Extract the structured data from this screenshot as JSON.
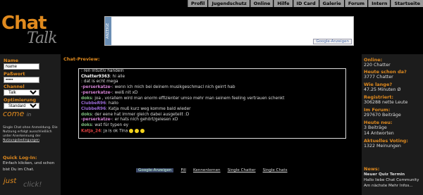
{
  "topnav": [
    "Profil",
    "Jugendschutz",
    "Online",
    "Hilfe",
    "ID Card",
    "Galerie",
    "Forum",
    "Intern",
    "Startseite"
  ],
  "logo": {
    "chat": "Chat",
    "talk": "Talk"
  },
  "ad": {
    "label": "ANZEIGE",
    "google": "Google-Anzeigen"
  },
  "login": {
    "name_label": "Name",
    "name_value": "Name",
    "password_label": "Paßwort",
    "password_value": "•••••",
    "channel_label": "Channel",
    "channel_value": "Talk",
    "opt_label": "Optimierung",
    "opt_value": "Standard",
    "come": "come",
    "come_small": "in",
    "note_text": "Single Chat ohne Anmeldung. Die Nutzung erfolgt ausschließlich unter Anerkennung der",
    "note_link": "Nutzungsbedingungen",
    "quick_title": "Quick Log-In:",
    "quick_text": "Einfach klicken, und schon bist Du im Chat.",
    "just": "just",
    "click": "click!"
  },
  "main": {
    "title": "Chat-Preview:",
    "lines": [
      {
        "name": "",
        "text": ": ren Intuitiv handeln",
        "color": "#dddddd"
      },
      {
        "name": "Chatter9363",
        "text": ": hi alle",
        "color": "#ffffff"
      },
      {
        "name": "",
        "text": ": dat is echt mega",
        "color": "#dddddd"
      },
      {
        "name": "-perserkatze-",
        "text": ": wenn ich mich bei deinem musikgeschmacl nich geirrt hab",
        "color": "#d080d0"
      },
      {
        "name": "-perserkatze-",
        "text": ": weiß nit xD",
        "color": "#d080d0"
      },
      {
        "name": "doks",
        "text": ": joa , vorallem wird man enorm effizienter umso mehr man seinem feeling vertrauen schenkt",
        "color": "#7fbf7f"
      },
      {
        "name": "ClubbeR96",
        "text": ": hallo",
        "color": "#9b6bd6"
      },
      {
        "name": "ClubbeR96",
        "text": ": Katja muß kurz weg komme bald wieder",
        "color": "#9b6bd6"
      },
      {
        "name": "doks",
        "text": ": der eene hat immer gleich dabei ausgeteilt :D",
        "color": "#7fbf7f"
      },
      {
        "name": "-perserkatze-",
        "text": ": er hats nich gehört/gelesen xD",
        "color": "#d080d0"
      },
      {
        "name": "doks",
        "text": ": wat für typen ey",
        "color": "#7fbf7f"
      },
      {
        "name": "Katja_24",
        "text": ": ja is ok Tina",
        "color": "#e04040"
      }
    ],
    "footer_links": [
      "Google-Anzeigen",
      "Fill",
      "Kennenlernen",
      "Single Chatter",
      "Single Chats"
    ],
    "colors": {
      "accent": "#e08a1e",
      "panel": "#1c1c1c"
    }
  },
  "stats": [
    {
      "title": "Online:",
      "value": "220 Chatter"
    },
    {
      "title": "Heute schon da?",
      "value": "3777 Chatter"
    },
    {
      "title": "Wie lange?",
      "value": "47.25 Minuten Ø"
    },
    {
      "title": "Registriert:",
      "value": "306288 nette Leute"
    },
    {
      "title": "Im Forum:",
      "value": "297670 Beiträge"
    },
    {
      "title": "Heute neu:",
      "value": "3 Beiträge"
    },
    {
      "title": "",
      "value": "14 Antworten"
    },
    {
      "title": "Aktuelles Voting:",
      "value": "1322 Meinungen"
    }
  ],
  "news": {
    "title": "News:",
    "headline": "Neuer Quiz Termin",
    "body": "Hallo liebe Chat Community Am nächste Mehr Infos...",
    "more": "Mehr Infos..."
  }
}
